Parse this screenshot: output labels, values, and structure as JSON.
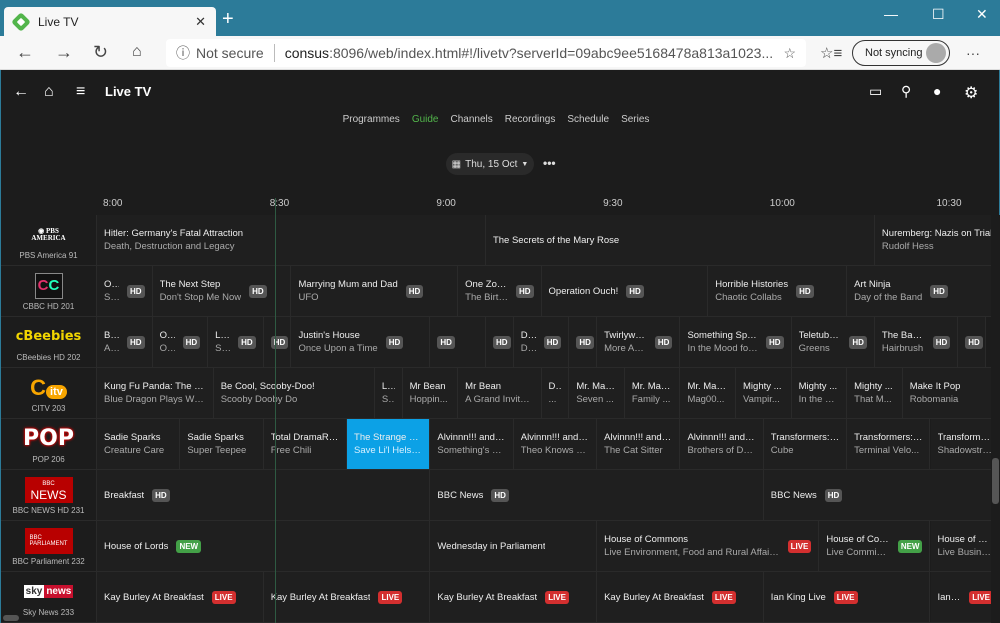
{
  "browser": {
    "tab_title": "Live TV",
    "tab_close": "✕",
    "new_tab": "+",
    "minimize": "—",
    "maximize": "☐",
    "close": "✕",
    "security": "Not secure",
    "url_host": "consus",
    "url_rest": ":8096/web/index.html#!/livetv?serverId=09abc9ee5168478a813a1023...",
    "sync": "Not syncing",
    "more": "···"
  },
  "app": {
    "title": "Live TV",
    "tabs": [
      "Programmes",
      "Guide",
      "Channels",
      "Recordings",
      "Schedule",
      "Series"
    ],
    "active_tab": "Guide",
    "date": "Thu, 15 Oct",
    "more": "•••"
  },
  "timeline": [
    "8:00",
    "8:30",
    "9:00",
    "9:30",
    "10:00",
    "10:30"
  ],
  "current_time": "08:32",
  "badge_colors": {
    "HD": "#555555",
    "LIVE": "#d32f2f",
    "NEW": "#43a047",
    "selected": "#0ca1e6",
    "accent": "#52b54b"
  },
  "channels": [
    {
      "name": "PBS America 91",
      "logo": "PBS AMERICA",
      "programs": [
        {
          "start": "08:00",
          "end": "09:10",
          "title": "Hitler: Germany's Fatal Attraction",
          "sub": "Death, Destruction and Legacy"
        },
        {
          "start": "09:10",
          "end": "10:20",
          "title": "The Secrets of the Mary Rose",
          "sub": ""
        },
        {
          "start": "10:20",
          "end": "11:00",
          "title": "Nuremberg: Nazis on Trial",
          "sub": "Rudolf Hess"
        }
      ]
    },
    {
      "name": "CBBC HD 201",
      "logo": "CBBC",
      "programs": [
        {
          "start": "08:00",
          "end": "08:10",
          "title": "O...",
          "sub": "Sl...",
          "badge": "HD"
        },
        {
          "start": "08:10",
          "end": "08:35",
          "title": "The Next Step",
          "sub": "Don't Stop Me Now",
          "badge": "HD"
        },
        {
          "start": "08:35",
          "end": "09:05",
          "title": "Marrying Mum and Dad",
          "sub": "UFO",
          "badge": "HD"
        },
        {
          "start": "09:05",
          "end": "09:20",
          "title": "One Zoo ...",
          "sub": "The Birth...",
          "badge": "HD"
        },
        {
          "start": "09:20",
          "end": "09:50",
          "title": "Operation Ouch!",
          "sub": "",
          "badge": "HD"
        },
        {
          "start": "09:50",
          "end": "10:15",
          "title": "Horrible Histories",
          "sub": "Chaotic Collabs",
          "badge": "HD"
        },
        {
          "start": "10:15",
          "end": "10:45",
          "title": "Art Ninja",
          "sub": "Day of the Band",
          "badge": "HD"
        }
      ]
    },
    {
      "name": "CBeebies HD 202",
      "logo": "CBeebies",
      "programs": [
        {
          "start": "08:00",
          "end": "08:10",
          "title": "Bit...",
          "sub": "Ah...",
          "badge": "HD"
        },
        {
          "start": "08:10",
          "end": "08:20",
          "title": "Oc...",
          "sub": "Oc...",
          "badge": "HD"
        },
        {
          "start": "08:20",
          "end": "08:30",
          "title": "Lo...",
          "sub": "Sl...",
          "badge": "HD"
        },
        {
          "start": "08:30",
          "end": "08:35",
          "title": "",
          "sub": "",
          "badge": "HD"
        },
        {
          "start": "08:35",
          "end": "09:00",
          "title": "Justin's House",
          "sub": "Once Upon a Time",
          "badge": "HD"
        },
        {
          "start": "09:00",
          "end": "09:10",
          "title": "",
          "sub": "",
          "badge": "HD"
        },
        {
          "start": "09:10",
          "end": "09:15",
          "title": "",
          "sub": "",
          "badge": "HD"
        },
        {
          "start": "09:15",
          "end": "09:25",
          "title": "Do...",
          "sub": "Do...",
          "badge": "HD"
        },
        {
          "start": "09:25",
          "end": "09:30",
          "title": "",
          "sub": "",
          "badge": "HD"
        },
        {
          "start": "09:30",
          "end": "09:45",
          "title": "Twirlywo...",
          "sub": "More Ab...",
          "badge": "HD"
        },
        {
          "start": "09:45",
          "end": "10:05",
          "title": "Something Spe...",
          "sub": "In the Mood for ...",
          "badge": "HD"
        },
        {
          "start": "10:05",
          "end": "10:20",
          "title": "Teletubbi...",
          "sub": "Greens",
          "badge": "HD"
        },
        {
          "start": "10:20",
          "end": "10:35",
          "title": "The Baby...",
          "sub": "Hairbrush",
          "badge": "HD"
        },
        {
          "start": "10:35",
          "end": "10:40",
          "title": "",
          "sub": "",
          "badge": "HD"
        }
      ]
    },
    {
      "name": "CITV 203",
      "logo": "CITV",
      "programs": [
        {
          "start": "08:00",
          "end": "08:21",
          "title": "Kung Fu Panda: The P...",
          "sub": "Blue Dragon Plays Wit..."
        },
        {
          "start": "08:21",
          "end": "08:50",
          "title": "Be Cool, Scooby-Doo!",
          "sub": "Scooby Dooby Do"
        },
        {
          "start": "08:50",
          "end": "08:55",
          "title": "L...",
          "sub": "S..."
        },
        {
          "start": "08:55",
          "end": "09:05",
          "title": "Mr Bean",
          "sub": "Hoppin..."
        },
        {
          "start": "09:05",
          "end": "09:20",
          "title": "Mr Bean",
          "sub": "A Grand Invitat..."
        },
        {
          "start": "09:20",
          "end": "09:25",
          "title": "D...",
          "sub": "..."
        },
        {
          "start": "09:25",
          "end": "09:35",
          "title": "Mr. Mag...",
          "sub": "Seven ..."
        },
        {
          "start": "09:35",
          "end": "09:45",
          "title": "Mr. Mag...",
          "sub": "Family ..."
        },
        {
          "start": "09:45",
          "end": "09:55",
          "title": "Mr. Mag...",
          "sub": "Mag00..."
        },
        {
          "start": "09:55",
          "end": "10:05",
          "title": "Mighty ...",
          "sub": "Vampir..."
        },
        {
          "start": "10:05",
          "end": "10:15",
          "title": "Mighty ...",
          "sub": "In the B..."
        },
        {
          "start": "10:15",
          "end": "10:25",
          "title": "Mighty ...",
          "sub": "That M..."
        },
        {
          "start": "10:25",
          "end": "11:00",
          "title": "Make It Pop",
          "sub": "Robomania"
        }
      ]
    },
    {
      "name": "POP 206",
      "logo": "POP",
      "programs": [
        {
          "start": "08:00",
          "end": "08:15",
          "title": "Sadie Sparks",
          "sub": "Creature Care"
        },
        {
          "start": "08:15",
          "end": "08:30",
          "title": "Sadie Sparks",
          "sub": "Super Teepee"
        },
        {
          "start": "08:30",
          "end": "08:45",
          "title": "Total DramaRa...",
          "sub": "Free Chili"
        },
        {
          "start": "08:45",
          "end": "09:00",
          "title": "The Strange C...",
          "sub": "Save Li'l Helsing",
          "selected": true
        },
        {
          "start": "09:00",
          "end": "09:15",
          "title": "Alvinnn!!! and t...",
          "sub": "Something's Fi..."
        },
        {
          "start": "09:15",
          "end": "09:30",
          "title": "Alvinnn!!! and t...",
          "sub": "Theo Knows B..."
        },
        {
          "start": "09:30",
          "end": "09:45",
          "title": "Alvinnn!!! and t...",
          "sub": "The Cat Sitter"
        },
        {
          "start": "09:45",
          "end": "10:00",
          "title": "Alvinnn!!! and t...",
          "sub": "Brothers of Da..."
        },
        {
          "start": "10:00",
          "end": "10:15",
          "title": "Transformers: ...",
          "sub": "Cube"
        },
        {
          "start": "10:15",
          "end": "10:30",
          "title": "Transformers: ...",
          "sub": "Terminal Velo..."
        },
        {
          "start": "10:30",
          "end": "10:45",
          "title": "Transformers",
          "sub": "Shadowstrike"
        }
      ]
    },
    {
      "name": "BBC NEWS HD 231",
      "logo": "BBC NEWS",
      "programs": [
        {
          "start": "08:00",
          "end": "09:00",
          "title": "Breakfast",
          "sub": "",
          "badge": "HD"
        },
        {
          "start": "09:00",
          "end": "10:00",
          "title": "BBC News",
          "sub": "",
          "badge": "HD"
        },
        {
          "start": "10:00",
          "end": "11:00",
          "title": "BBC News",
          "sub": "",
          "badge": "HD"
        }
      ]
    },
    {
      "name": "BBC Parliament 232",
      "logo": "BBC PARLIAMENT",
      "programs": [
        {
          "start": "08:00",
          "end": "09:00",
          "title": "House of Lords",
          "sub": "",
          "badge": "NEW"
        },
        {
          "start": "09:00",
          "end": "09:30",
          "title": "Wednesday in Parliament",
          "sub": ""
        },
        {
          "start": "09:30",
          "end": "10:10",
          "title": "House of Commons",
          "sub": "Live Environment, Food and Rural Affairs Questi...",
          "badge": "LIVE"
        },
        {
          "start": "10:10",
          "end": "10:30",
          "title": "House of Commons",
          "sub": "Live Commissioners ...",
          "badge": "NEW"
        },
        {
          "start": "10:30",
          "end": "11:00",
          "title": "House of Commons",
          "sub": "Live Business"
        }
      ]
    },
    {
      "name": "Sky News 233",
      "logo": "sky news",
      "programs": [
        {
          "start": "08:00",
          "end": "08:30",
          "title": "Kay Burley At Breakfast",
          "sub": "",
          "badge": "LIVE"
        },
        {
          "start": "08:30",
          "end": "09:00",
          "title": "Kay Burley At Breakfast",
          "sub": "",
          "badge": "LIVE"
        },
        {
          "start": "09:00",
          "end": "09:30",
          "title": "Kay Burley At Breakfast",
          "sub": "",
          "badge": "LIVE"
        },
        {
          "start": "09:30",
          "end": "10:00",
          "title": "Kay Burley At Breakfast",
          "sub": "",
          "badge": "LIVE"
        },
        {
          "start": "10:00",
          "end": "10:30",
          "title": "Ian King Live",
          "sub": "",
          "badge": "LIVE"
        },
        {
          "start": "10:30",
          "end": "11:00",
          "title": "Ian King Live",
          "sub": "",
          "badge": "LIVE"
        }
      ]
    }
  ]
}
